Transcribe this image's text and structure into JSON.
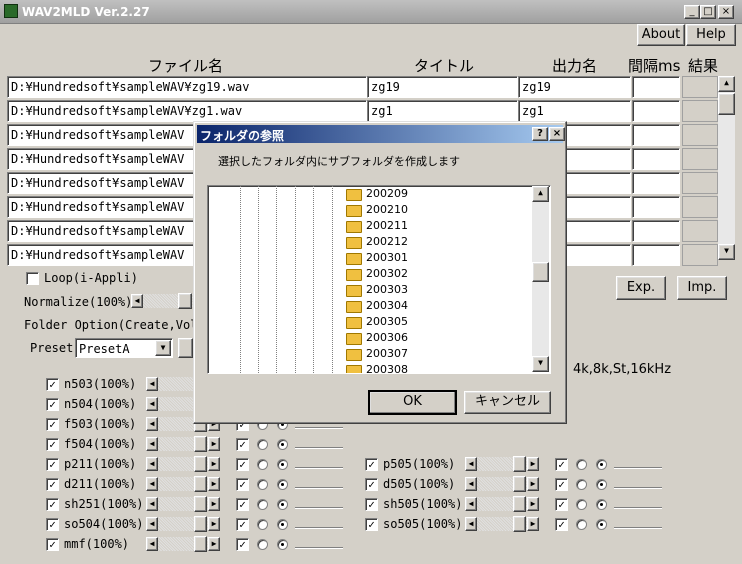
{
  "window": {
    "title": "WAV2MLD Ver.2.27",
    "min": "_",
    "max": "□",
    "close": "×"
  },
  "toolbar": {
    "about": "About",
    "help": "Help"
  },
  "headers": {
    "file": "ファイル名",
    "title": "タイトル",
    "output": "出力名",
    "interval": "間隔ms",
    "result": "結果"
  },
  "rows": [
    {
      "file": "D:¥Hundredsoft¥sampleWAV¥zg19.wav",
      "title": "zg19",
      "output": "zg19"
    },
    {
      "file": "D:¥Hundredsoft¥sampleWAV¥zg1.wav",
      "title": "zg1",
      "output": "zg1"
    },
    {
      "file": "D:¥Hundredsoft¥sampleWAV",
      "title": "",
      "output": ""
    },
    {
      "file": "D:¥Hundredsoft¥sampleWAV",
      "title": "",
      "output": ""
    },
    {
      "file": "D:¥Hundredsoft¥sampleWAV",
      "title": "",
      "output": ""
    },
    {
      "file": "D:¥Hundredsoft¥sampleWAV",
      "title": "",
      "output": ""
    },
    {
      "file": "D:¥Hundredsoft¥sampleWAV",
      "title": "",
      "output": ""
    },
    {
      "file": "D:¥Hundredsoft¥sampleWAV",
      "title": "",
      "output": ""
    }
  ],
  "options": {
    "loop": "Loop(i-Appli)",
    "normalize": "Normalize(100%)",
    "folder_option": "Folder Option(Create,Vol",
    "preset_label": "Preset",
    "preset_value": "PresetA",
    "exp": "Exp.",
    "imp": "Imp.",
    "freq_label": "4k,8k,St,16kHz"
  },
  "left_formats": [
    "n503(100%)",
    "n504(100%)",
    "f503(100%)",
    "f504(100%)",
    "p211(100%)",
    "d211(100%)",
    "sh251(100%)",
    "so504(100%)",
    "mmf(100%)"
  ],
  "right_formats": [
    "p505(100%)",
    "d505(100%)",
    "sh505(100%)",
    "so505(100%)"
  ],
  "dialog": {
    "title": "フォルダの参照",
    "help": "?",
    "close": "×",
    "message": "選択したフォルダ内にサブフォルダを作成します",
    "ok": "OK",
    "cancel": "キャンセル",
    "folders": [
      "200209",
      "200210",
      "200211",
      "200212",
      "200301",
      "200302",
      "200303",
      "200304",
      "200305",
      "200306",
      "200307",
      "200308"
    ]
  }
}
